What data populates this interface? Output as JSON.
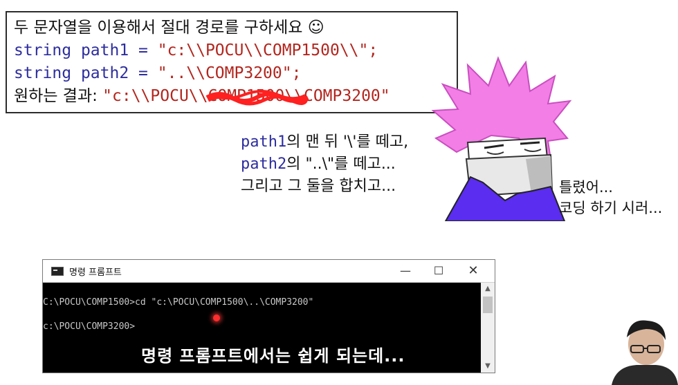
{
  "code_box": {
    "line1": "두 문자열을 이용해서 절대 경로를 구하세요 ☺",
    "line2_kw": "string",
    "line2_var": " path1 = ",
    "line2_str": "\"c:\\\\POCU\\\\COMP1500\\\\\";",
    "line3_kw": "string",
    "line3_var": " path2 = ",
    "line3_str": "\"..\\\\COMP3200\";",
    "line4_label": "원하는  결과: ",
    "line4_str_a": "\"c:\\\\POCU\\\\",
    "line4_str_struck": "COMP1500\\\\",
    "line4_str_b": "COMP3200\""
  },
  "bubble": {
    "l1_code": "path1",
    "l1_text": "의 맨 뒤 '\\'를 떼고,",
    "l2_code": "path2",
    "l2_text": "의 \"..\\\"를 떼고...",
    "l3_text": "그리고 그 둘을 합치고..."
  },
  "side": {
    "l1": "틀렸어...",
    "l2": "코딩 하기 시러..."
  },
  "cmd": {
    "title": "명령 프롬프트",
    "icon": "cmd-icon",
    "min_label": "—",
    "max_label": "☐",
    "close_label": "✕",
    "line1": "C:\\POCU\\COMP1500>cd \"c:\\POCU\\COMP1500\\..\\COMP3200\"",
    "line2": "c:\\POCU\\COMP3200>",
    "caption": "명령 프롬프트에서는 쉽게 되는데..."
  },
  "colors": {
    "keyword": "#2d2d9e",
    "string": "#b3261e",
    "hair": "#f27ee6",
    "shirt": "#5a2df0",
    "scribble": "#ff2020"
  }
}
